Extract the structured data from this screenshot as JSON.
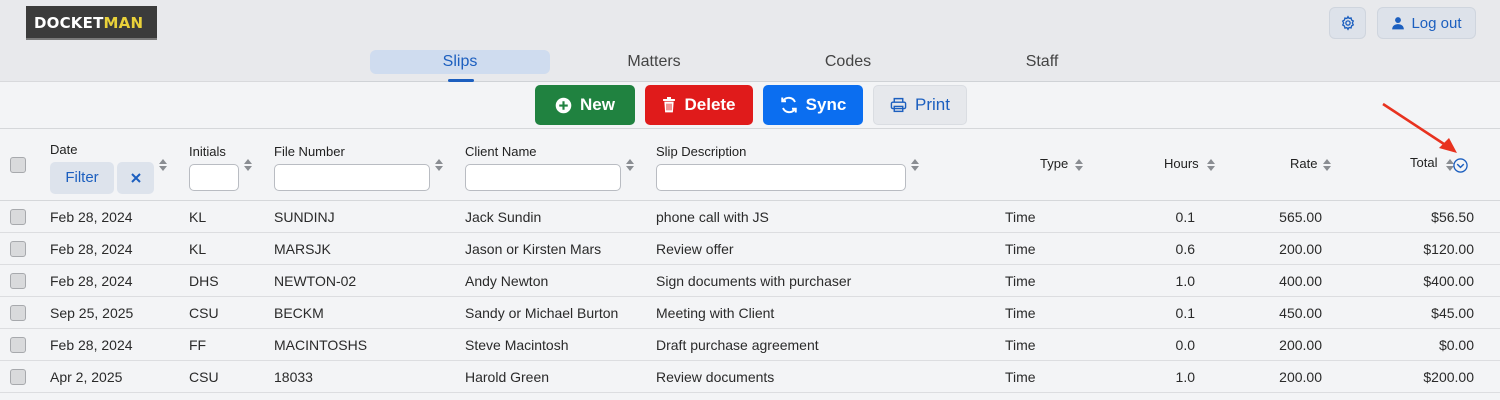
{
  "app": {
    "logo_part1": "DOCKET",
    "logo_part2": "MAN",
    "logout_label": "Log out"
  },
  "tabs": [
    {
      "label": "Slips",
      "active": true
    },
    {
      "label": "Matters",
      "active": false
    },
    {
      "label": "Codes",
      "active": false
    },
    {
      "label": "Staff",
      "active": false
    }
  ],
  "toolbar": {
    "new_label": "New",
    "delete_label": "Delete",
    "sync_label": "Sync",
    "print_label": "Print"
  },
  "columns": {
    "date": "Date",
    "initials": "Initials",
    "file_number": "File Number",
    "client_name": "Client Name",
    "slip_description": "Slip Description",
    "type": "Type",
    "hours": "Hours",
    "rate": "Rate",
    "total": "Total"
  },
  "filters": {
    "filter_label": "Filter",
    "clear_label": "✕",
    "initials_value": "",
    "file_number_value": "",
    "client_name_value": "",
    "slip_description_value": ""
  },
  "rows": [
    {
      "date": "Feb 28, 2024",
      "initials": "KL",
      "file_number": "SUNDINJ",
      "client_name": "Jack Sundin",
      "description": "phone call with JS",
      "type": "Time",
      "hours": "0.1",
      "rate": "565.00",
      "total": "$56.50"
    },
    {
      "date": "Feb 28, 2024",
      "initials": "KL",
      "file_number": "MARSJK",
      "client_name": "Jason or Kirsten Mars",
      "description": "Review offer",
      "type": "Time",
      "hours": "0.6",
      "rate": "200.00",
      "total": "$120.00"
    },
    {
      "date": "Feb 28, 2024",
      "initials": "DHS",
      "file_number": "NEWTON-02",
      "client_name": "Andy Newton",
      "description": "Sign documents with purchaser",
      "type": "Time",
      "hours": "1.0",
      "rate": "400.00",
      "total": "$400.00"
    },
    {
      "date": "Sep 25, 2025",
      "initials": "CSU",
      "file_number": "BECKM",
      "client_name": "Sandy or Michael Burton",
      "description": "Meeting with Client",
      "type": "Time",
      "hours": "0.1",
      "rate": "450.00",
      "total": "$45.00"
    },
    {
      "date": "Feb 28, 2024",
      "initials": "FF",
      "file_number": "MACINTOSHS",
      "client_name": "Steve Macintosh",
      "description": "Draft purchase agreement",
      "type": "Time",
      "hours": "0.0",
      "rate": "200.00",
      "total": "$0.00"
    },
    {
      "date": "Apr 2, 2025",
      "initials": "CSU",
      "file_number": "18033",
      "client_name": "Harold Green",
      "description": "Review documents",
      "type": "Time",
      "hours": "1.0",
      "rate": "200.00",
      "total": "$200.00"
    }
  ],
  "colors": {
    "accent": "#1c5fbf",
    "new_button": "#208240",
    "delete_button": "#e01b1b",
    "sync_button": "#0b6ef0",
    "annotation_arrow": "#e8321f"
  },
  "icons": {
    "settings": "gear-icon",
    "logout": "user-icon",
    "new": "plus-circle-icon",
    "delete": "trash-icon",
    "sync": "sync-icon",
    "print": "printer-icon",
    "sort": "sort-icon",
    "column_menu": "chevron-down-circle-icon"
  }
}
